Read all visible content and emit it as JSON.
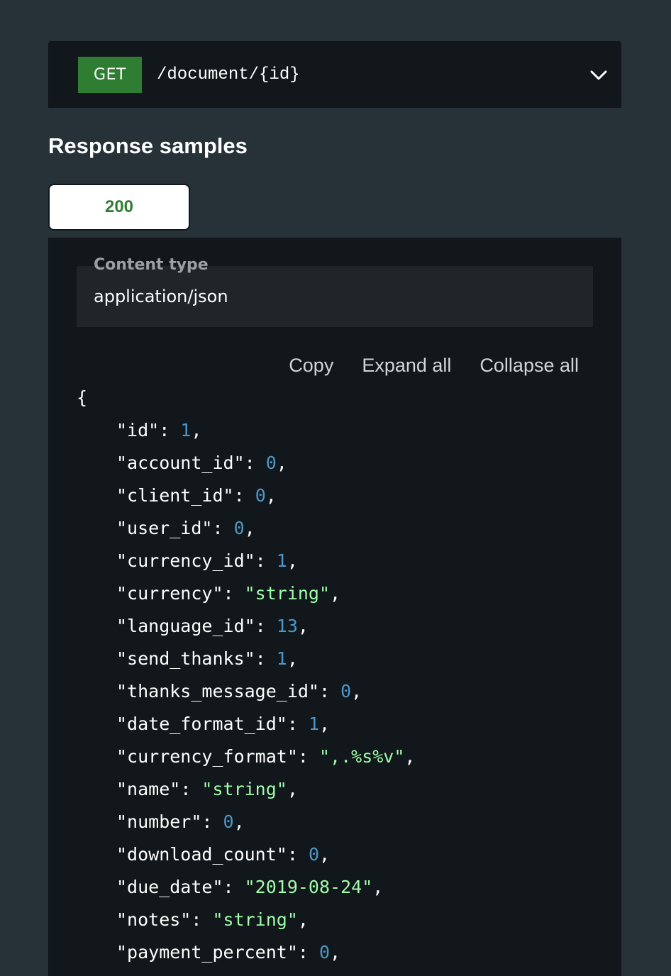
{
  "endpoint": {
    "method": "GET",
    "path": "/document/{id}",
    "expand_icon": "chevron-down-icon"
  },
  "response_samples": {
    "title": "Response samples",
    "status_tab": "200",
    "content_type_label": "Content type",
    "content_type_value": "application/json",
    "toolbar": {
      "copy": "Copy",
      "expand_all": "Expand all",
      "collapse_all": "Collapse all"
    },
    "json_open_brace": "{",
    "json_lines": [
      {
        "key": "\"id\"",
        "value": "1",
        "type": "number"
      },
      {
        "key": "\"account_id\"",
        "value": "0",
        "type": "number"
      },
      {
        "key": "\"client_id\"",
        "value": "0",
        "type": "number"
      },
      {
        "key": "\"user_id\"",
        "value": "0",
        "type": "number"
      },
      {
        "key": "\"currency_id\"",
        "value": "1",
        "type": "number"
      },
      {
        "key": "\"currency\"",
        "value": "\"string\"",
        "type": "string"
      },
      {
        "key": "\"language_id\"",
        "value": "13",
        "type": "number"
      },
      {
        "key": "\"send_thanks\"",
        "value": "1",
        "type": "number"
      },
      {
        "key": "\"thanks_message_id\"",
        "value": "0",
        "type": "number"
      },
      {
        "key": "\"date_format_id\"",
        "value": "1",
        "type": "number"
      },
      {
        "key": "\"currency_format\"",
        "value": "\",.%s%v\"",
        "type": "string"
      },
      {
        "key": "\"name\"",
        "value": "\"string\"",
        "type": "string"
      },
      {
        "key": "\"number\"",
        "value": "0",
        "type": "number"
      },
      {
        "key": "\"download_count\"",
        "value": "0",
        "type": "number"
      },
      {
        "key": "\"due_date\"",
        "value": "\"2019-08-24\"",
        "type": "string"
      },
      {
        "key": "\"notes\"",
        "value": "\"string\"",
        "type": "string"
      },
      {
        "key": "\"payment_percent\"",
        "value": "0",
        "type": "number"
      }
    ]
  },
  "colors": {
    "background": "#263238",
    "panel": "#11171a",
    "method_get": "#2e7d32",
    "status_success": "#2e7d32",
    "json_number": "#4d96c9",
    "json_string": "#a0fbaa"
  }
}
